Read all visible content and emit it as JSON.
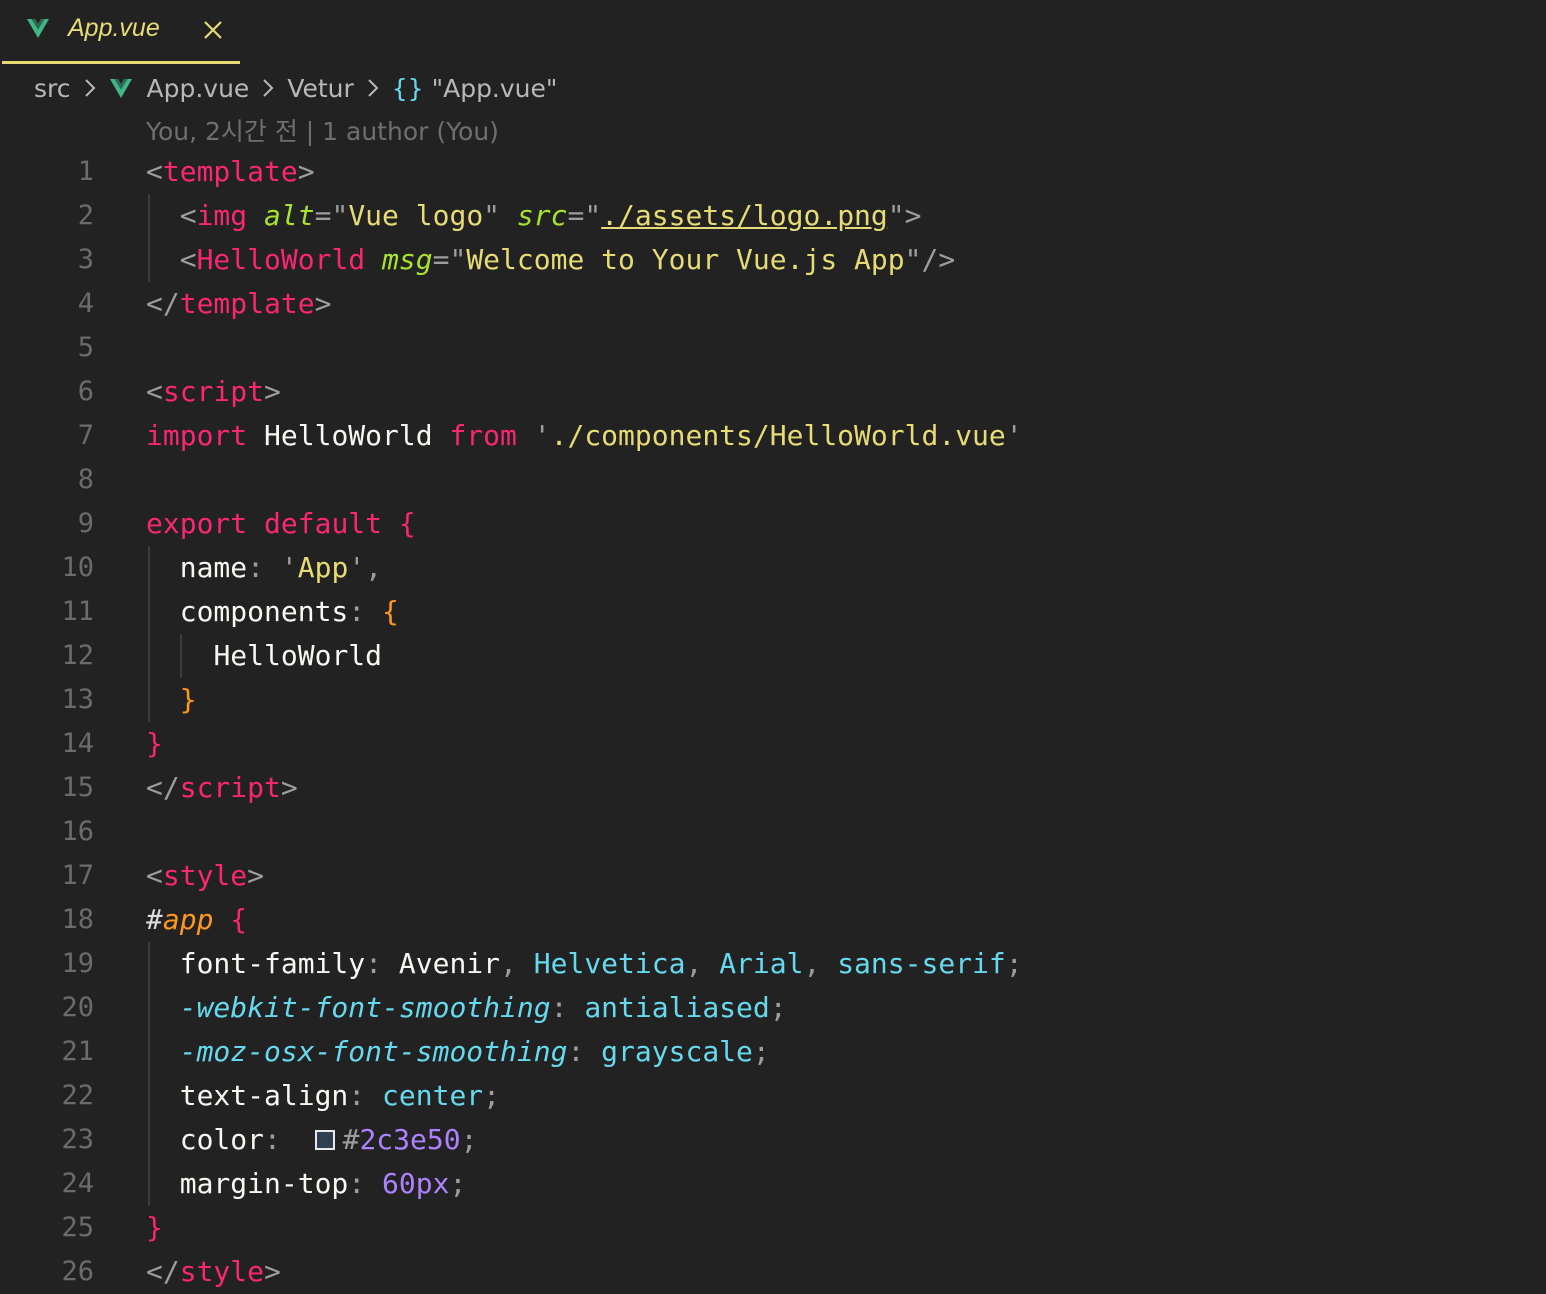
{
  "tab": {
    "title": "App.vue",
    "icon": "vue-icon",
    "close_icon": "close-icon"
  },
  "breadcrumb": {
    "items": [
      "src",
      "App.vue",
      "Vetur",
      "{}",
      "\"App.vue\""
    ]
  },
  "codelens": "You, 2시간 전 | 1 author (You)",
  "line_numbers": [
    "1",
    "2",
    "3",
    "4",
    "5",
    "6",
    "7",
    "8",
    "9",
    "10",
    "11",
    "12",
    "13",
    "14",
    "15",
    "16",
    "17",
    "18",
    "19",
    "20",
    "21",
    "22",
    "23",
    "24",
    "25",
    "26"
  ],
  "code": {
    "l1": {
      "open": "<",
      "tag": "template",
      "close": ">"
    },
    "l2": {
      "open": "<",
      "tag": "img",
      "attr1": "alt",
      "eq": "=",
      "q": "\"",
      "alt": "Vue logo",
      "attr2": "src",
      "src": "./assets/logo.png",
      "close": ">"
    },
    "l3": {
      "open": "<",
      "tag": "HelloWorld",
      "attr": "msg",
      "eq": "=",
      "q": "\"",
      "msg": "Welcome to Your Vue.js App",
      "close": "/>"
    },
    "l4": {
      "open": "</",
      "tag": "template",
      "close": ">"
    },
    "l6": {
      "open": "<",
      "tag": "script",
      "close": ">"
    },
    "l7": {
      "import": "import",
      "ident": "HelloWorld",
      "from": "from",
      "q": "'",
      "path": "./components/HelloWorld.vue"
    },
    "l9": {
      "export": "export",
      "default": "default",
      "brace": "{"
    },
    "l10": {
      "key": "name",
      "colon": ":",
      "q": "'",
      "value": "App",
      "comma": ","
    },
    "l11": {
      "key": "components",
      "colon": ":",
      "brace": "{"
    },
    "l12": {
      "ident": "HelloWorld"
    },
    "l13": {
      "brace": "}"
    },
    "l14": {
      "brace": "}"
    },
    "l15": {
      "open": "</",
      "tag": "script",
      "close": ">"
    },
    "l17": {
      "open": "<",
      "tag": "style",
      "close": ">"
    },
    "l18": {
      "hash": "#",
      "selector": "app",
      "brace": "{"
    },
    "l19": {
      "prop": "font-family",
      "colon": ":",
      "v1": "Avenir",
      "comma": ",",
      "v2": "Helvetica",
      "v3": "Arial",
      "v4": "sans-serif",
      "semi": ";"
    },
    "l20": {
      "prop": "-webkit-font-smoothing",
      "colon": ":",
      "value": "antialiased",
      "semi": ";"
    },
    "l21": {
      "prop": "-moz-osx-font-smoothing",
      "colon": ":",
      "value": "grayscale",
      "semi": ";"
    },
    "l22": {
      "prop": "text-align",
      "colon": ":",
      "value": "center",
      "semi": ";"
    },
    "l23": {
      "prop": "color",
      "colon": ":",
      "hash": "#",
      "value": "2c3e50",
      "semi": ";"
    },
    "l24": {
      "prop": "margin-top",
      "colon": ":",
      "value": "60px",
      "semi": ";"
    },
    "l25": {
      "brace": "}"
    },
    "l26": {
      "open": "</",
      "tag": "style",
      "close": ">"
    }
  },
  "colors": {
    "background": "#222222",
    "accent": "#e6db74",
    "keyword": "#f92672",
    "attribute": "#a6e22e",
    "string": "#e6db74",
    "css_value": "#66d9ef",
    "number": "#ae81ff",
    "brace": "#fd971f",
    "swatch_color": "#2c3e50"
  }
}
